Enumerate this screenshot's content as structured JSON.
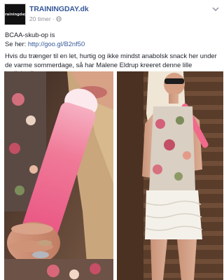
{
  "post": {
    "page_name": "TRAININGDAY.dk",
    "timestamp": "20 timer",
    "avatar_text": "trainingday",
    "line1": "BCAA-skub-op is",
    "line2_prefix": "Se her: ",
    "link": "http://goo.gl/B2nf50",
    "body": "Hvis du trænger til en let, hurtig og ikke mindst anabolsk snack her under de varme sommerdage, så har Malene Eldrup kreeret denne lille herlighed!"
  },
  "icons": {
    "visibility": "globe-icon",
    "menu": "chevron-down-icon"
  },
  "colors": {
    "link": "#365899",
    "meta": "#90949c",
    "popsicle": "#f06a8c"
  }
}
